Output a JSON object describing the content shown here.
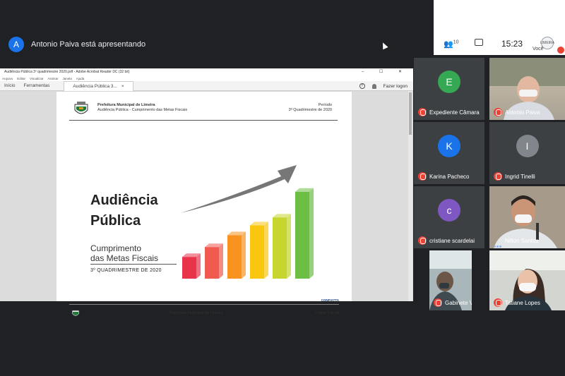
{
  "presenter": {
    "initial": "A",
    "text": "Antonio Paiva está apresentando",
    "avatar_color": "#1a73e8"
  },
  "controls": {
    "people_count": "10",
    "time": "15:23",
    "you_label": "Você",
    "avatar_text": "LIMEIRA"
  },
  "acrobat": {
    "window_title": "Audiência Pública 3º quadrimestre 2020.pdf - Adobe Acrobat Reader DC (32 bit)",
    "window_buttons": "–  ☐  ✕",
    "menu": [
      "Arquivo",
      "Editar",
      "Visualizar",
      "Assinar",
      "Janela",
      "Ajuda"
    ],
    "tabs": [
      {
        "label": "Início"
      },
      {
        "label": "Ferramentas"
      },
      {
        "label": "Audiência Pública 3...",
        "close": "×"
      }
    ],
    "login": "Fazer logon"
  },
  "slide": {
    "header_org": "Prefeitura Municipal de Limeira",
    "header_sub": "Audiência Pública - Cumprimento das Metas Fiscais",
    "period_label": "Período",
    "period_value": "3º Quadrimestre de 2020",
    "title_line1": "Audiência",
    "title_line2": "Pública",
    "subtitle_line1": "Cumprimento",
    "subtitle_line2": "das Metas Fiscais",
    "subtitle_line3": "3º QUADRIMESTRE DE 2020",
    "logo_text": "CONFIATTA",
    "footer_text": "Prefeitura Municipal de Limeira",
    "footer_page": "Página 1 de 48",
    "bar_colors": [
      "#e8334a",
      "#f05a4f",
      "#f7931e",
      "#f9c710",
      "#c6d62e",
      "#6cbe45"
    ],
    "bar_levels": [
      0.22,
      0.32,
      0.44,
      0.54,
      0.62,
      0.88
    ]
  },
  "participants": [
    {
      "name": "Expediente Câmara",
      "initial": "E",
      "color": "#34a853",
      "video": false
    },
    {
      "name": "Antonio Paiva",
      "video": true
    },
    {
      "name": "Karina Pacheco",
      "initial": "K",
      "color": "#1a73e8",
      "video": false
    },
    {
      "name": "Ingrid Tinelli",
      "initial": "I",
      "color": "#80868b",
      "video": false
    },
    {
      "name": "cristiane scardelai",
      "initial": "c",
      "color": "#7e57c2",
      "video": false
    },
    {
      "name": "Nilton Santos",
      "video": true
    },
    {
      "name": "Gabinete Vereador ...",
      "video": true
    },
    {
      "name": "Tatiane Lopes",
      "video": true
    }
  ]
}
